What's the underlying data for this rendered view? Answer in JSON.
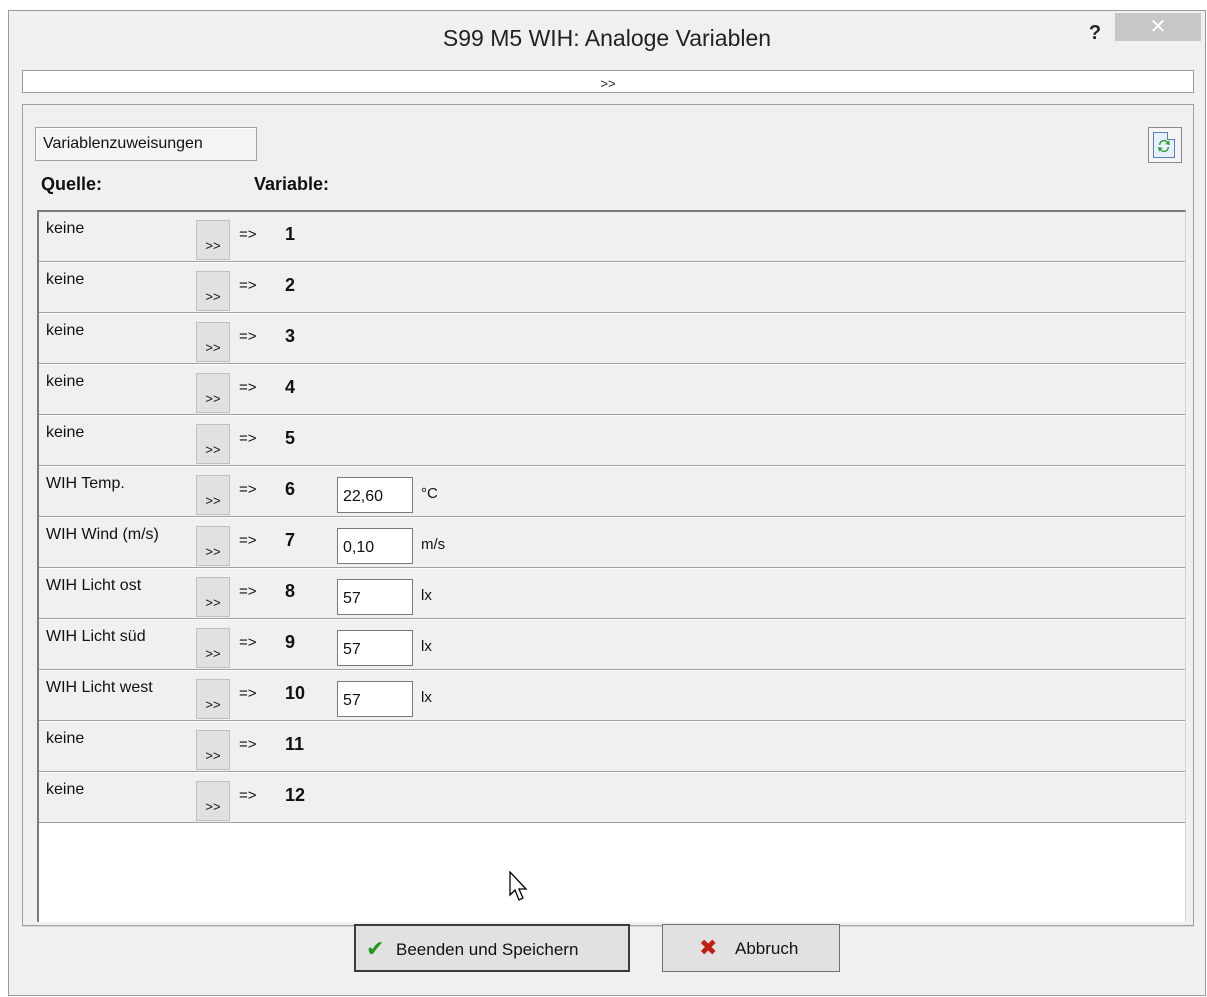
{
  "window": {
    "title": "S99 M5 WIH: Analoge Variablen",
    "help_label": "?",
    "close_label": "✕"
  },
  "expand_bar": {
    "label": ">>"
  },
  "tab": {
    "label": "Variablenzuweisungen"
  },
  "headers": {
    "source": "Quelle:",
    "variable": "Variable:"
  },
  "rows": [
    {
      "source": "keine",
      "pick": ">>",
      "arrow": "=>",
      "num": "1"
    },
    {
      "source": "keine",
      "pick": ">>",
      "arrow": "=>",
      "num": "2"
    },
    {
      "source": "keine",
      "pick": ">>",
      "arrow": "=>",
      "num": "3"
    },
    {
      "source": "keine",
      "pick": ">>",
      "arrow": "=>",
      "num": "4"
    },
    {
      "source": "keine",
      "pick": ">>",
      "arrow": "=>",
      "num": "5"
    },
    {
      "source": "WIH Temp.",
      "pick": ">>",
      "arrow": "=>",
      "num": "6",
      "value": "22,60",
      "unit": "°C"
    },
    {
      "source": "WIH Wind (m/s)",
      "pick": ">>",
      "arrow": "=>",
      "num": "7",
      "value": "0,10",
      "unit": "m/s"
    },
    {
      "source": "WIH Licht ost",
      "pick": ">>",
      "arrow": "=>",
      "num": "8",
      "value": "57",
      "unit": "lx"
    },
    {
      "source": "WIH Licht süd",
      "pick": ">>",
      "arrow": "=>",
      "num": "9",
      "value": "57",
      "unit": "lx"
    },
    {
      "source": "WIH Licht west",
      "pick": ">>",
      "arrow": "=>",
      "num": "10",
      "value": "57",
      "unit": "lx"
    },
    {
      "source": "keine",
      "pick": ">>",
      "arrow": "=>",
      "num": "11"
    },
    {
      "source": "keine",
      "pick": ">>",
      "arrow": "=>",
      "num": "12"
    }
  ],
  "buttons": {
    "save_label": "Beenden und Speichern",
    "save_icon": "checkmark-icon",
    "cancel_label": "Abbruch",
    "cancel_icon": "x-icon"
  },
  "colors": {
    "save_icon": "#1f9a1f",
    "cancel_icon": "#c0200f",
    "refresh_icon": "#2a9d2a"
  }
}
